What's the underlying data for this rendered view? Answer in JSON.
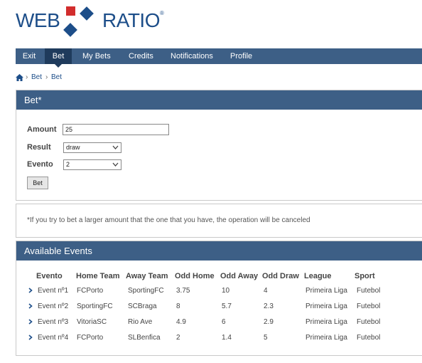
{
  "logo": {
    "left": "WEB",
    "right": "RATIO",
    "reg": "®"
  },
  "nav": {
    "items": [
      {
        "label": "Exit"
      },
      {
        "label": "Bet"
      },
      {
        "label": "My Bets"
      },
      {
        "label": "Credits"
      },
      {
        "label": "Notifications"
      },
      {
        "label": "Profile"
      }
    ],
    "active": "Bet"
  },
  "breadcrumb": {
    "sep": "›",
    "items": [
      "Bet",
      "Bet"
    ]
  },
  "bet_panel": {
    "title": "Bet*",
    "amount_label": "Amount",
    "amount_value": "25",
    "result_label": "Result",
    "result_value": "draw",
    "evento_label": "Evento",
    "evento_value": "2",
    "button_label": "Bet"
  },
  "note": {
    "text": "*If you try to bet a larger amount that the one that you have, the operation will be canceled"
  },
  "events_panel": {
    "title": "Available Events",
    "headers": [
      "Evento",
      "Home Team",
      "Away Team",
      "Odd Home",
      "Odd Away",
      "Odd Draw",
      "League",
      "Sport"
    ],
    "rows": [
      [
        "Event nº1",
        "FCPorto",
        "SportingFC",
        "3.75",
        "10",
        "4",
        "Primeira Liga",
        "Futebol"
      ],
      [
        "Event nº2",
        "SportingFC",
        "SCBraga",
        "8",
        "5.7",
        "2.3",
        "Primeira Liga",
        "Futebol"
      ],
      [
        "Event nº3",
        "VitoriaSC",
        "Rio Ave",
        "4.9",
        "6",
        "2.9",
        "Primeira Liga",
        "Futebol"
      ],
      [
        "Event nº4",
        "FCPorto",
        "SLBenfica",
        "2",
        "1.4",
        "5",
        "Primeira Liga",
        "Futebol"
      ]
    ]
  },
  "colors": {
    "brand_blue": "#1d4e89",
    "brand_red": "#d22d2d",
    "nav_bg": "#3d5f86",
    "nav_active": "#1f3b5c"
  },
  "icons": {
    "home": "home-icon",
    "row": "chevron-right-icon",
    "select": "chevron-down-icon"
  }
}
